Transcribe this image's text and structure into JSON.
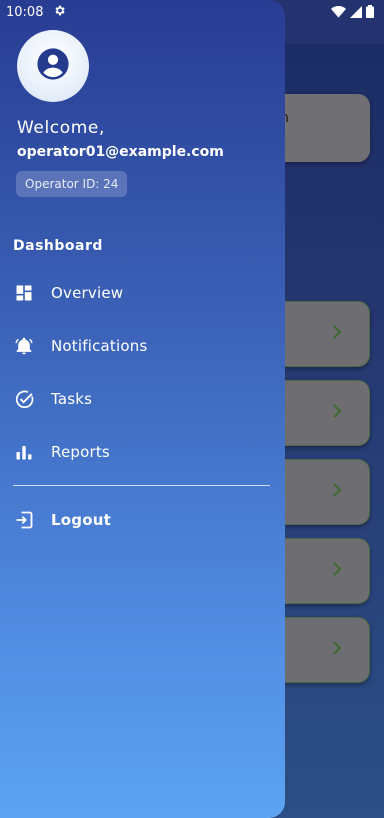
{
  "status_bar": {
    "time": "10:08",
    "icons": [
      "settings-gear-icon",
      "wifi-icon",
      "signal-icon",
      "battery-icon"
    ]
  },
  "background": {
    "card_partial_text": "n",
    "card_count": 5
  },
  "drawer": {
    "welcome": "Welcome,",
    "email": "operator01@example.com",
    "operator_badge": "Operator ID: 24",
    "section_title": "Dashboard",
    "menu": [
      {
        "label": "Overview",
        "icon": "dashboard-icon"
      },
      {
        "label": "Notifications",
        "icon": "bell-icon"
      },
      {
        "label": "Tasks",
        "icon": "check-circle-icon"
      },
      {
        "label": "Reports",
        "icon": "bar-chart-icon"
      }
    ],
    "logout": {
      "label": "Logout",
      "icon": "logout-icon"
    }
  },
  "colors": {
    "drawer_top": "#283c93",
    "drawer_bottom": "#5ca3f3",
    "card_grey": "#6e6e72",
    "chevron_green": "#3e6a2f"
  }
}
